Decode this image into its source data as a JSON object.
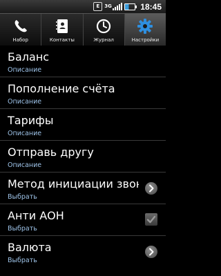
{
  "status": {
    "time": "18:45",
    "network": "3G",
    "notification": "E"
  },
  "tabs": [
    {
      "label": "Набор",
      "icon": "phone-icon",
      "active": false
    },
    {
      "label": "Контакты",
      "icon": "contacts-icon",
      "active": false
    },
    {
      "label": "Журнал",
      "icon": "clock-icon",
      "active": false
    },
    {
      "label": "Настройки",
      "icon": "gear-icon",
      "active": true
    }
  ],
  "settings": [
    {
      "title": "Баланс",
      "subtitle": "Описание"
    },
    {
      "title": "Пополнение счёта",
      "subtitle": "Описание"
    },
    {
      "title": "Тарифы",
      "subtitle": "Описание"
    },
    {
      "title": "Отправь другу",
      "subtitle": "Описание"
    },
    {
      "title": "Метод инициации звон",
      "subtitle": "Выбрать",
      "control": "chevron-right-icon"
    },
    {
      "title": "Анти АОН",
      "subtitle": "Выбрать",
      "control": "checkbox",
      "checked": true
    },
    {
      "title": "Валюта",
      "subtitle": "Выбрать",
      "control": "chevron-right-icon"
    }
  ],
  "colors": {
    "background": "#000000",
    "subtitle": "#9ec3e8",
    "divider": "#3a3a3a"
  }
}
